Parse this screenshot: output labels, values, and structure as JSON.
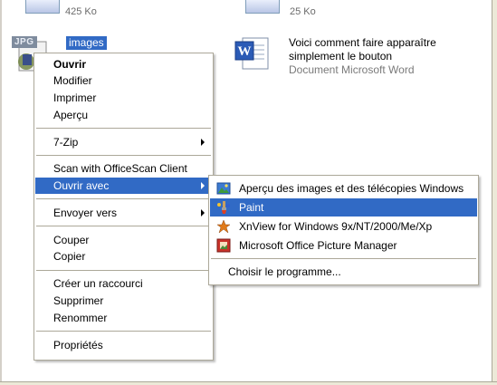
{
  "top_files": {
    "left_size": "425 Ko",
    "right_size": "25 Ko"
  },
  "selected_file": {
    "badge": "JPG",
    "name": "images"
  },
  "word_file": {
    "line1": "Voici comment faire apparaître",
    "line2": "simplement le bouton",
    "type": "Document Microsoft Word"
  },
  "context_menu": {
    "open": "Ouvrir",
    "edit": "Modifier",
    "print": "Imprimer",
    "preview": "Aperçu",
    "zip": "7-Zip",
    "scan": "Scan with OfficeScan Client",
    "open_with": "Ouvrir avec",
    "send_to": "Envoyer vers",
    "cut": "Couper",
    "copy": "Copier",
    "shortcut": "Créer un raccourci",
    "delete": "Supprimer",
    "rename": "Renommer",
    "properties": "Propriétés"
  },
  "open_with_menu": {
    "preview_app": "Aperçu des images et des télécopies Windows",
    "paint": "Paint",
    "xnview": "XnView for Windows 9x/NT/2000/Me/Xp",
    "picture_manager": "Microsoft Office Picture Manager",
    "choose": "Choisir le programme..."
  },
  "colors": {
    "highlight": "#316ac5",
    "menu_border": "#aca899"
  }
}
